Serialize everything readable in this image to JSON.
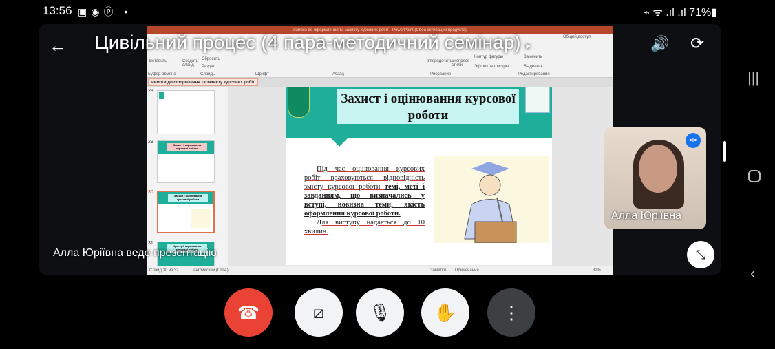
{
  "status_bar": {
    "time": "13:56",
    "notification_icons": [
      "gallery-icon",
      "chrome-icon",
      "pinterest-icon",
      "dot"
    ],
    "battery": "71%",
    "system_icons": [
      "saver-icon",
      "mute-icon",
      "wifi-icon",
      "signal-icon",
      "signal-icon"
    ]
  },
  "meeting": {
    "title": "Цивільний процес (4 пара-методичний семінар)",
    "presenting_label": "Алла Юріївна веде презентацію",
    "self_tile_name": "Алла Юріївна"
  },
  "powerpoint": {
    "window_title": "вимоги до оформлення та захисту курсових робіт - PowerPoint (Сбой активации продукта)",
    "share_label": "Общий доступ",
    "ribbon": {
      "paste": "Вставить",
      "create_slide": "Создать слайд",
      "reset": "Сбросить",
      "section": "Раздел",
      "arrange": "Упорядочить",
      "quick_styles": "Экспресс-стили",
      "shape_outline": "Контур фигуры",
      "shape_effects": "Эффекты фигуры",
      "replace": "Заменить",
      "select": "Выделить",
      "groups": [
        "Буфер обмена",
        "Слайды",
        "Шрифт",
        "Абзац",
        "Рисование",
        "Редактирование"
      ]
    },
    "doc_tab": "вимоги до оформлення та захисту курсових робіт",
    "thumbnails": [
      {
        "number": "28",
        "title": ""
      },
      {
        "number": "29",
        "title": "Захист і оцінювання курсової роботи"
      },
      {
        "number": "30",
        "title": "Захист і оцінювання курсової роботи",
        "selected": true
      },
      {
        "number": "31",
        "title": "Критерії оцінювання курсової роботи"
      }
    ],
    "slide": {
      "title": "Захист і оцінювання курсової роботи",
      "para1_plain": "Під час оцінювання курсових робіт враховуються відповідність змісту курсової роботи ",
      "para1_bold": "темі, меті і завданням, що визначались у вступі, новизна теми, якість оформлення курсової роботи.",
      "para2": "Для виступу надається до 10 хвилин."
    },
    "status": {
      "slide_counter": "Слайд 30 из 32",
      "language": "английский (США)",
      "notes": "Заметки",
      "comments": "Примечания",
      "zoom": "82%"
    }
  },
  "controls": {
    "end_call_color": "#ea4335",
    "buttons": [
      "end-call",
      "camera-off",
      "mic-off",
      "raise-hand",
      "more-options"
    ]
  }
}
